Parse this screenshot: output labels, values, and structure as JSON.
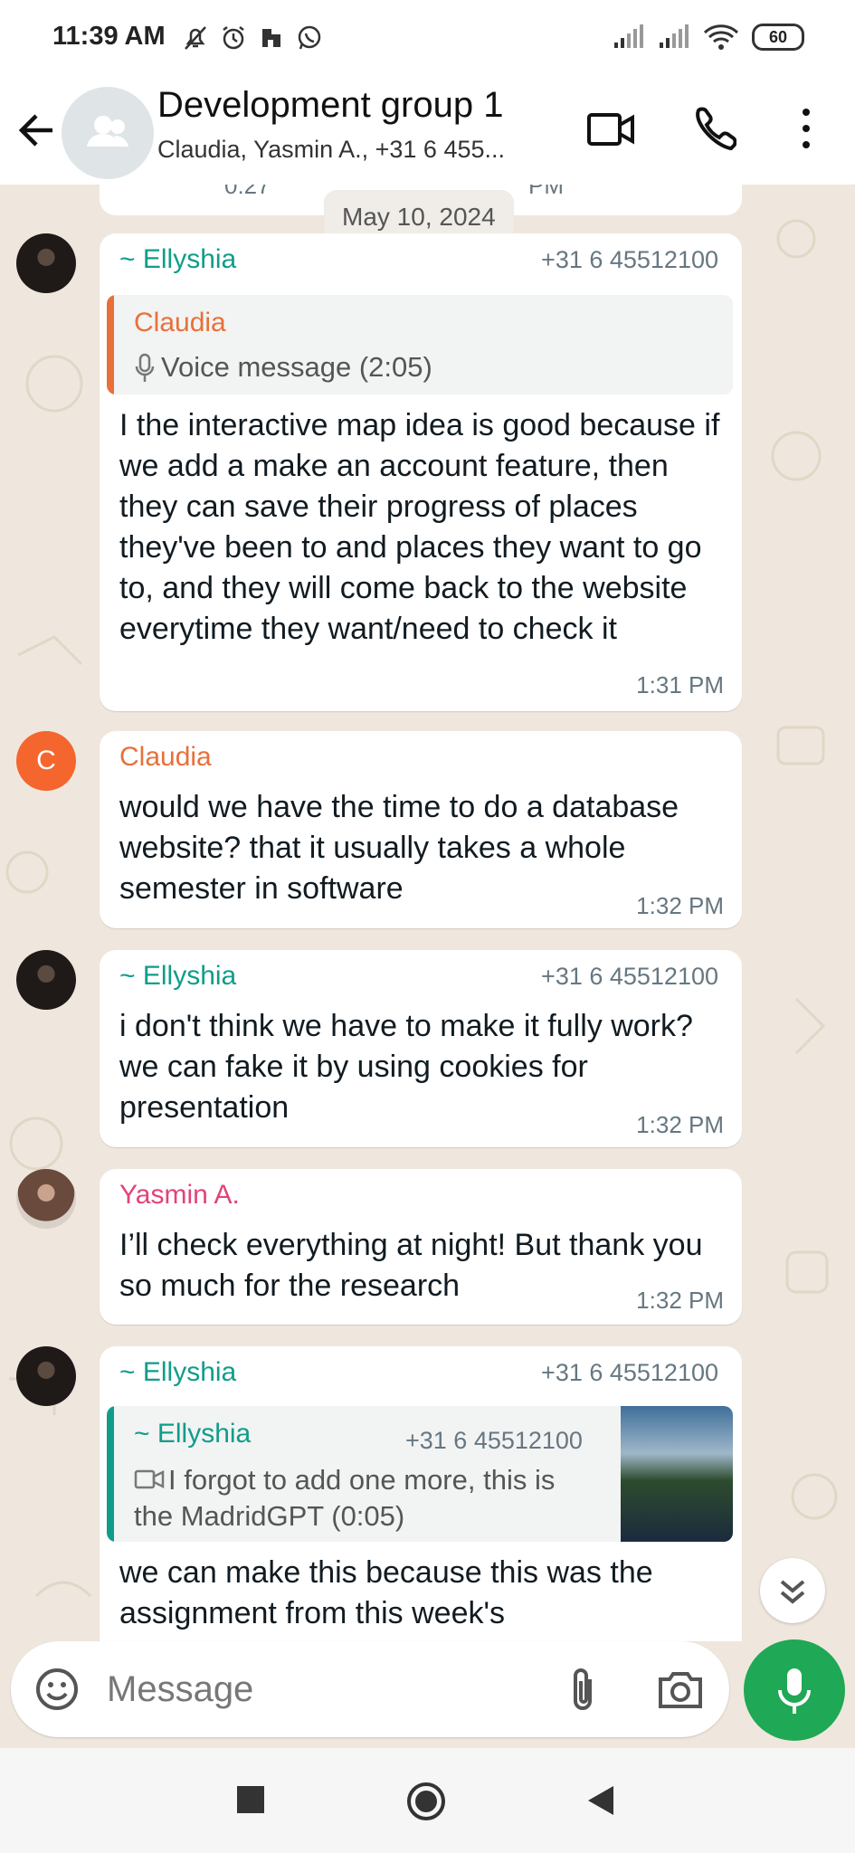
{
  "status_bar": {
    "time": "11:39 AM",
    "icons": [
      "mute-icon",
      "alarm-icon",
      "app-icon",
      "whatsapp-icon"
    ],
    "battery": "60"
  },
  "header": {
    "title": "Development group 1",
    "subtitle": "Claudia, Yasmin A., +31 6 455..."
  },
  "chat": {
    "cut_off_top": {
      "left": "0:27",
      "right": "PM"
    },
    "date_chip": "May 10, 2024",
    "messages": [
      {
        "sender": "~ Ellyshia",
        "phone": "+31 6 45512100",
        "quote": {
          "name": "Claudia",
          "text": "Voice message (2:05)"
        },
        "text": "I the interactive map idea is good because if we add a make an account feature, then they can save their progress of places they've been to and places they want to go to, and they will come back to the website everytime they want/need to check it",
        "time": "1:31 PM"
      },
      {
        "sender": "Claudia",
        "avatar_letter": "C",
        "text": "would we have the time to do a database website? that it usually takes a whole semester in software",
        "time": "1:32 PM"
      },
      {
        "sender": "~ Ellyshia",
        "phone": "+31 6 45512100",
        "text": "i don't think we have to make it fully work? we can fake it by using cookies for presentation",
        "time": "1:32 PM"
      },
      {
        "sender": "Yasmin A.",
        "text": "I’ll check everything at night! But thank you so much for the research",
        "time": "1:32 PM"
      },
      {
        "sender": "~ Ellyshia",
        "phone": "+31 6 45512100",
        "quote": {
          "name": "~ Ellyshia",
          "phone": "+31 6 45512100",
          "text": "I forgot to add one more, this is the MadridGPT (0:05)"
        },
        "text": "we can make this because this was the assignment from this week's"
      }
    ]
  },
  "composer": {
    "placeholder": "Message"
  },
  "colors": {
    "accent": "#1fa855",
    "teal": "#0f9d8a",
    "orange": "#e8703a",
    "pink": "#e0447a",
    "chat_bg": "#efe7dd"
  }
}
